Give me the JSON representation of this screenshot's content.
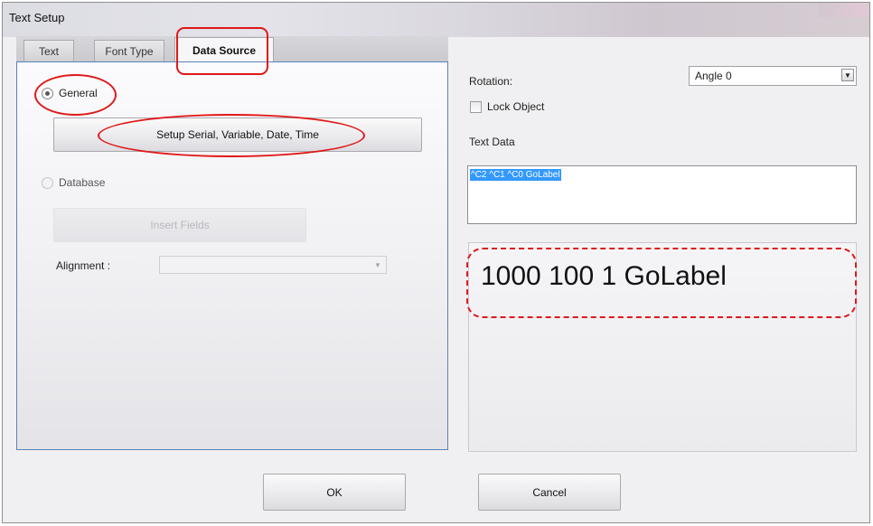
{
  "window": {
    "title": "Text Setup"
  },
  "tabs": [
    {
      "label": "Text"
    },
    {
      "label": "Font Type"
    },
    {
      "label": "Data Source"
    }
  ],
  "data_source": {
    "general_label": "General",
    "setup_button_label": "Setup Serial, Variable, Date, Time",
    "database_label": "Database",
    "insert_fields_label": "Insert Fields",
    "alignment_label": "Alignment :",
    "alignment_value": ""
  },
  "right": {
    "rotation_label": "Rotation:",
    "rotation_value": "Angle 0",
    "lock_object_label": "Lock Object",
    "text_data_label": "Text Data",
    "text_data_value": "^C2 ^C1 ^C0 GoLabel",
    "preview_text": "1000 100 1 GoLabel"
  },
  "buttons": {
    "ok_label": "OK",
    "cancel_label": "Cancel"
  },
  "icons": {
    "dropdown_arrow": "chevron-down-icon",
    "radio": "radio-button-icon",
    "checkbox": "checkbox-icon"
  },
  "colors": {
    "annotation": "#e01818",
    "selection": "#3399ff",
    "panel_border": "#5a83b6"
  }
}
